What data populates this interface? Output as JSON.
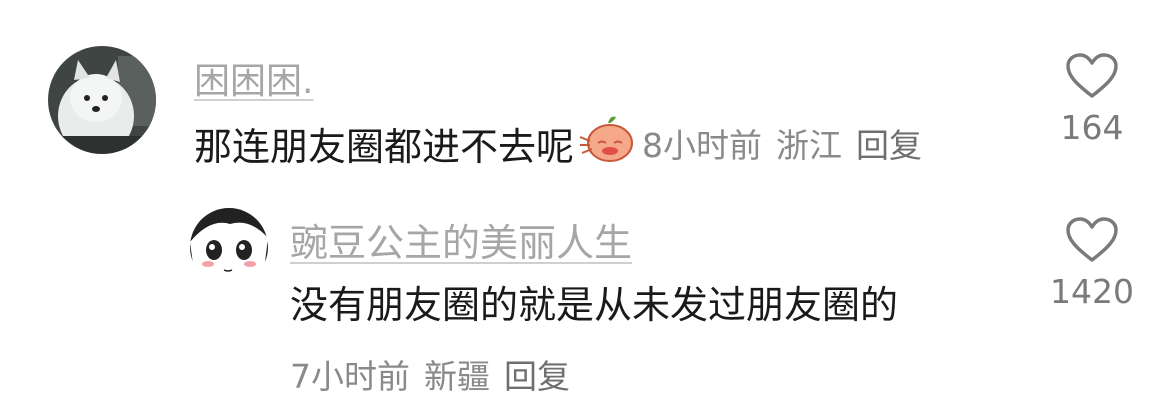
{
  "comments": [
    {
      "username": "困困困.",
      "text": "那连朋友圈都进不去呢",
      "emoji": "sticker-face-emoji",
      "time": "8小时前",
      "location": "浙江",
      "reply_label": "回复",
      "likes": "164",
      "avatar": "white-dog-avatar"
    },
    {
      "username": "豌豆公主的美丽人生",
      "text": "没有朋友圈的就是从未发过朋友圈的",
      "time": "7小时前",
      "location": "新疆",
      "reply_label": "回复",
      "likes": "1420",
      "avatar": "manga-girl-avatar"
    }
  ],
  "colors": {
    "username": "#a6a6a6",
    "text": "#1a1a1a",
    "meta": "#8a8a8a",
    "heart": "#7a7a7a"
  }
}
